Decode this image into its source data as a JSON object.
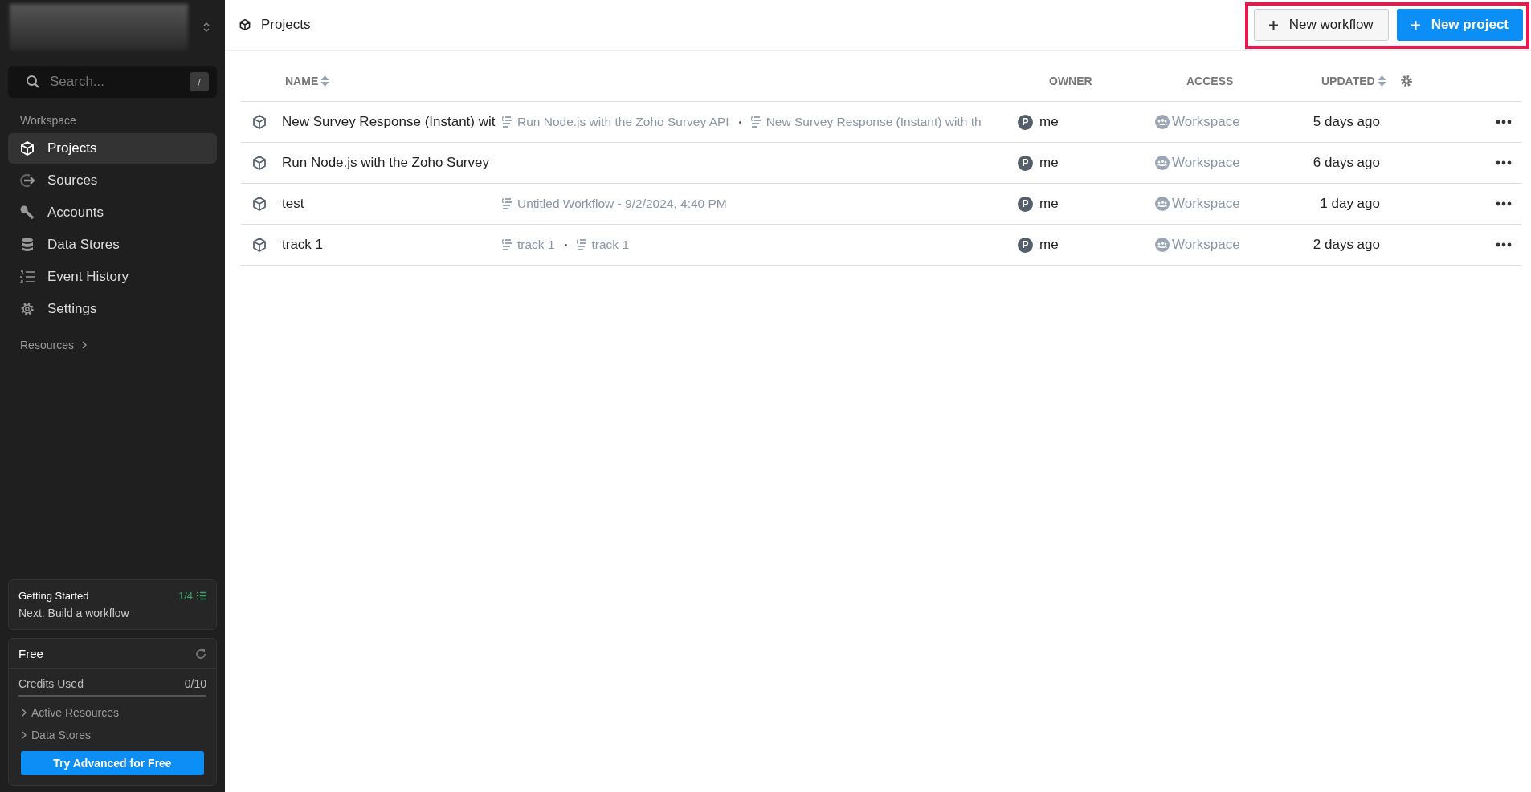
{
  "sidebar": {
    "search": {
      "placeholder": "Search...",
      "shortcut": "/"
    },
    "section_label": "Workspace",
    "items": [
      {
        "label": "Projects",
        "selected": true
      },
      {
        "label": "Sources",
        "selected": false
      },
      {
        "label": "Accounts",
        "selected": false
      },
      {
        "label": "Data Stores",
        "selected": false
      },
      {
        "label": "Event History",
        "selected": false
      },
      {
        "label": "Settings",
        "selected": false
      }
    ],
    "resources_label": "Resources",
    "getting_started": {
      "title": "Getting Started",
      "progress": "1/4",
      "next": "Next: Build a workflow"
    },
    "plan": {
      "name": "Free",
      "credits_label": "Credits Used",
      "credits_value": "0/10",
      "links": [
        "Active Resources",
        "Data Stores"
      ],
      "upgrade_button": "Try Advanced for Free"
    }
  },
  "header": {
    "title": "Projects",
    "buttons": [
      {
        "label": "New workflow",
        "kind": "secondary"
      },
      {
        "label": "New project",
        "kind": "primary"
      }
    ]
  },
  "table": {
    "columns": [
      {
        "label": "NAME",
        "sortable": true
      },
      {
        "label": "OWNER",
        "sortable": false
      },
      {
        "label": "ACCESS",
        "sortable": false
      },
      {
        "label": "UPDATED",
        "sortable": true
      }
    ],
    "rows": [
      {
        "name": "New Survey Response (Instant) wit",
        "workflows": [
          "Run Node.js with the Zoho Survey API",
          "New Survey Response (Instant) with th"
        ],
        "owner_initial": "P",
        "owner": "me",
        "access": "Workspace",
        "updated": "5 days ago"
      },
      {
        "name": "Run Node.js with the Zoho Survey",
        "workflows": [],
        "owner_initial": "P",
        "owner": "me",
        "access": "Workspace",
        "updated": "6 days ago"
      },
      {
        "name": "test",
        "workflows": [
          "Untitled Workflow - 9/2/2024, 4:40 PM"
        ],
        "owner_initial": "P",
        "owner": "me",
        "access": "Workspace",
        "updated": "1 day ago"
      },
      {
        "name": "track 1",
        "workflows": [
          "track 1",
          "track 1"
        ],
        "owner_initial": "P",
        "owner": "me",
        "access": "Workspace",
        "updated": "2 days ago"
      }
    ]
  }
}
